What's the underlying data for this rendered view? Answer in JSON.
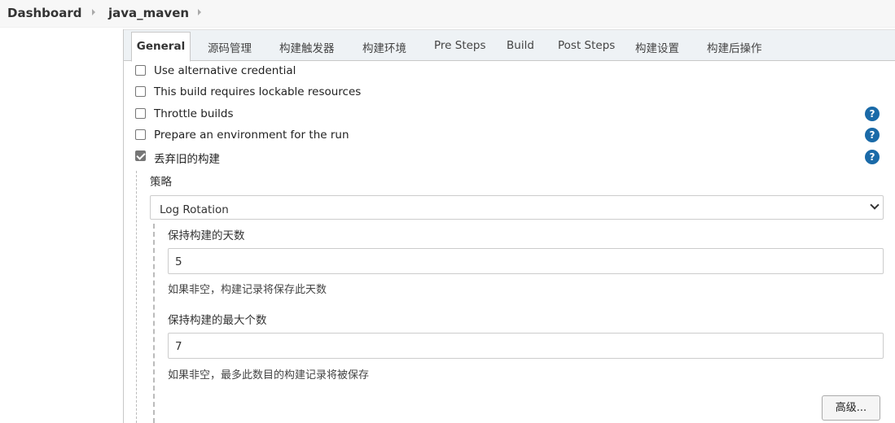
{
  "breadcrumb": {
    "items": [
      {
        "label": "Dashboard"
      },
      {
        "label": "java_maven"
      }
    ]
  },
  "tabs": [
    {
      "label": "General",
      "active": true
    },
    {
      "label": "源码管理"
    },
    {
      "label": "构建触发器"
    },
    {
      "label": "构建环境"
    },
    {
      "label": "Pre Steps"
    },
    {
      "label": "Build"
    },
    {
      "label": "Post Steps"
    },
    {
      "label": "构建设置"
    },
    {
      "label": "构建后操作"
    }
  ],
  "options": [
    {
      "label": "Use alternative credential",
      "checked": false,
      "help": false
    },
    {
      "label": "This build requires lockable resources",
      "checked": false,
      "help": false
    },
    {
      "label": "Throttle builds",
      "checked": false,
      "help": true
    },
    {
      "label": "Prepare an environment for the run",
      "checked": false,
      "help": true
    },
    {
      "label": "丢弃旧的构建",
      "checked": true,
      "help": true
    }
  ],
  "help_glyph": "?",
  "discard": {
    "strategy_label": "策略",
    "strategy_value": "Log Rotation",
    "days_label": "保持构建的天数",
    "days_value": "5",
    "days_hint": "如果非空，构建记录将保存此天数",
    "max_label": "保持构建的最大个数",
    "max_value": "7",
    "max_hint": "如果非空，最多此数目的构建记录将被保存",
    "advanced_label": "高级..."
  },
  "colors": {
    "help_icon": "#1a6aa8",
    "tabbar_bg": "#eef2f5"
  }
}
